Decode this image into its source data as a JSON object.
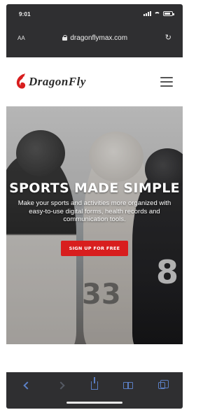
{
  "status_bar": {
    "time": "9:01"
  },
  "browser": {
    "text_size_label": "AA",
    "url": "dragonflymax.com",
    "icons": {
      "lock": "lock-icon",
      "reload": "reload-icon"
    }
  },
  "site_header": {
    "logo_text": "DragonFly",
    "menu_icon": "hamburger-menu-icon"
  },
  "hero": {
    "title": "SPORTS MADE SIMPLE",
    "subtitle": "Make your sports and activities more organized with easy-to-use digital forms, health records and communication tools.",
    "cta_label": "SIGN UP FOR FREE",
    "jersey_numbers": [
      "33",
      "8"
    ]
  },
  "toolbar": {
    "buttons": [
      "back-icon",
      "forward-icon",
      "share-icon",
      "bookmarks-icon",
      "tabs-icon"
    ]
  },
  "colors": {
    "brand_red": "#d81e1e",
    "browser_chrome": "#2f2f31",
    "toolbar_accent": "#5b7fc4"
  }
}
